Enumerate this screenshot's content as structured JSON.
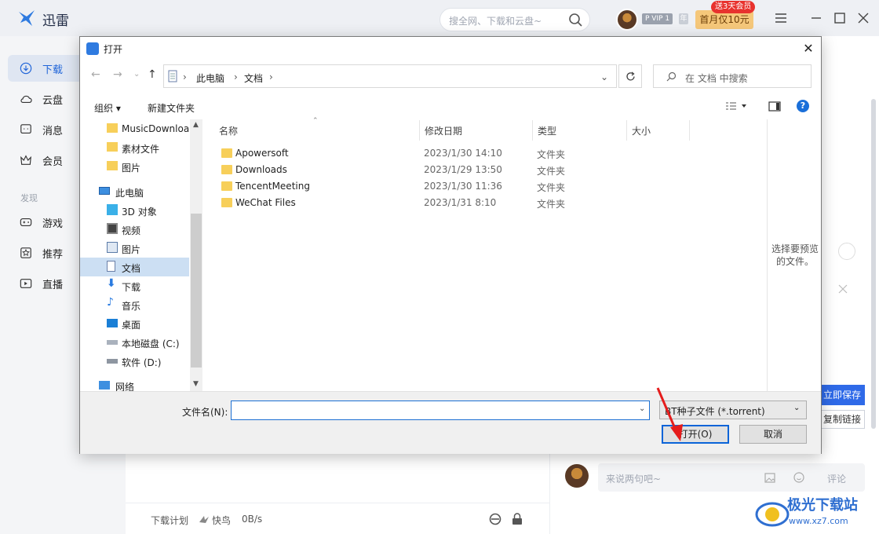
{
  "app": {
    "name": "迅雷",
    "search_placeholder": "搜全网、下载和云盘~",
    "vip_label": "P VIP 1",
    "year_label": "年",
    "promo_label": "首月仅10元",
    "promo_tag": "送3天会员"
  },
  "sidebar": {
    "items": [
      {
        "label": "下载",
        "icon": "download-icon"
      },
      {
        "label": "云盘",
        "icon": "cloud-icon"
      },
      {
        "label": "消息",
        "icon": "message-icon"
      },
      {
        "label": "会员",
        "icon": "crown-icon"
      }
    ],
    "discover_label": "发现",
    "discover_items": [
      {
        "label": "游戏",
        "icon": "gamepad-icon"
      },
      {
        "label": "推荐",
        "icon": "star-icon"
      },
      {
        "label": "直播",
        "icon": "live-icon"
      }
    ]
  },
  "status_bar": {
    "plan_label": "下载计划",
    "speed_mode": "快鸟",
    "speed_value": "0B/s"
  },
  "right_panel": {
    "save_now": "立即保存",
    "copy_link": "复制链接",
    "comment_placeholder": "来说两句吧~",
    "comment_submit": "评论"
  },
  "watermark": {
    "text": "极光下载站",
    "url": "www.xz7.com"
  },
  "dialog": {
    "title": "打开",
    "breadcrumb": [
      "此电脑",
      "文档"
    ],
    "search_placeholder": "在 文档 中搜索",
    "organize_label": "组织 ▾",
    "new_folder_label": "新建文件夹",
    "columns": [
      "名称",
      "修改日期",
      "类型",
      "大小"
    ],
    "nav_tree": [
      {
        "label": "MusicDownloa",
        "icon": "folder-icon"
      },
      {
        "label": "素材文件",
        "icon": "folder-icon"
      },
      {
        "label": "图片",
        "icon": "folder-icon"
      },
      {
        "label": "此电脑",
        "icon": "computer-icon"
      },
      {
        "label": "3D 对象",
        "icon": "cube-icon"
      },
      {
        "label": "视频",
        "icon": "video-icon"
      },
      {
        "label": "图片",
        "icon": "picture-icon"
      },
      {
        "label": "文档",
        "icon": "document-icon"
      },
      {
        "label": "下载",
        "icon": "download-arrow-icon"
      },
      {
        "label": "音乐",
        "icon": "music-icon"
      },
      {
        "label": "桌面",
        "icon": "desktop-icon"
      },
      {
        "label": "本地磁盘 (C:)",
        "icon": "drive-icon"
      },
      {
        "label": "软件 (D:)",
        "icon": "drive-icon"
      },
      {
        "label": "网络",
        "icon": "network-icon"
      }
    ],
    "files": [
      {
        "name": "Apowersoft",
        "date": "2023/1/30 14:10",
        "type": "文件夹"
      },
      {
        "name": "Downloads",
        "date": "2023/1/29 13:50",
        "type": "文件夹"
      },
      {
        "name": "TencentMeeting",
        "date": "2023/1/30 11:36",
        "type": "文件夹"
      },
      {
        "name": "WeChat Files",
        "date": "2023/1/31 8:10",
        "type": "文件夹"
      }
    ],
    "preview_text": "选择要预览的文件。",
    "filename_label": "文件名(N):",
    "filename_value": "",
    "filetype_label": "BT种子文件 (*.torrent)",
    "open_label": "打开(O)",
    "cancel_label": "取消"
  }
}
